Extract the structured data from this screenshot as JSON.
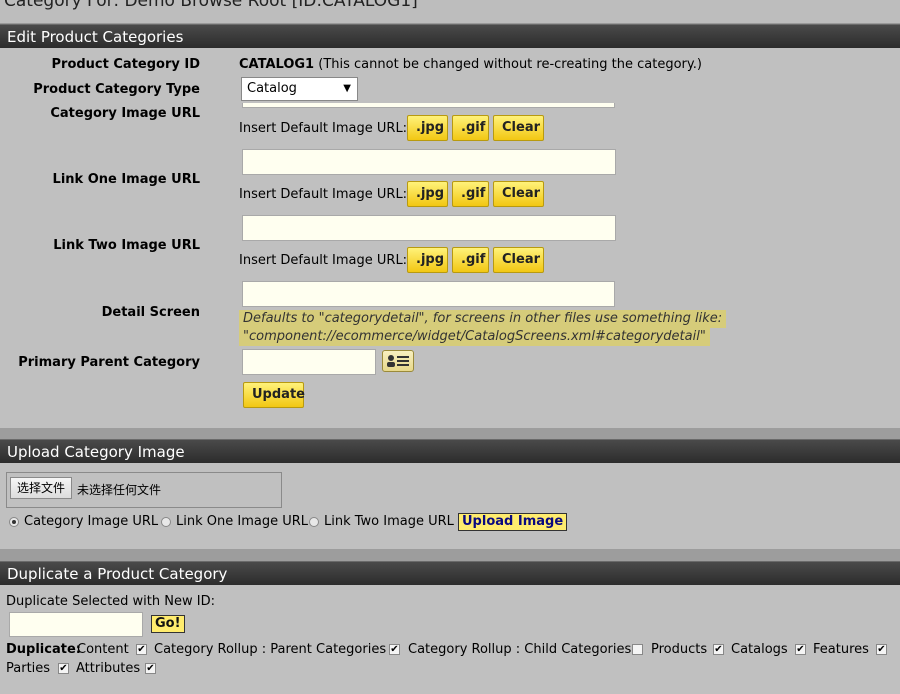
{
  "page_title": "Category For: Demo Browse Root [ID:CATALOG1]",
  "edit_section": {
    "title": "Edit Product Categories",
    "category_id_label": "Product Category ID",
    "category_id_value": "CATALOG1",
    "category_id_note": "(This cannot be changed without re-creating the category.)",
    "type_label": "Product Category Type",
    "type_value": "Catalog",
    "category_image_label": "Category Image URL",
    "link_one_label": "Link One Image URL",
    "link_two_label": "Link Two Image URL",
    "insert_default_label": "Insert Default Image URL:",
    "jpg_label": ".jpg",
    "gif_label": ".gif",
    "clear_label": "Clear",
    "detail_screen_label": "Detail Screen",
    "detail_screen_tooltip_line1": "Defaults to \"categorydetail\", for screens in other files use something like:",
    "detail_screen_tooltip_line2": "\"component://ecommerce/widget/CatalogScreens.xml#categorydetail\"",
    "primary_parent_label": "Primary Parent Category",
    "update_label": "Update"
  },
  "upload_section": {
    "title": "Upload Category Image",
    "choose_file_label": "选择文件",
    "no_file_label": "未选择任何文件",
    "radio_options": [
      "Category Image URL",
      "Link One Image URL",
      "Link Two Image URL"
    ],
    "selected_radio": "Category Image URL",
    "upload_label": "Upload Image"
  },
  "duplicate_section": {
    "title": "Duplicate a Product Category",
    "prompt": "Duplicate Selected with New ID:",
    "go_label": "Go!",
    "duplicate_label": "Duplicate:",
    "options": [
      {
        "label": "Content",
        "checked": true
      },
      {
        "label": "Category Rollup : Parent Categories",
        "checked": true
      },
      {
        "label": "Category Rollup : Child Categories",
        "checked": false
      },
      {
        "label": "Products",
        "checked": true
      },
      {
        "label": "Catalogs",
        "checked": true
      },
      {
        "label": "Features",
        "checked": true
      },
      {
        "label": "Parties",
        "checked": true
      },
      {
        "label": "Attributes",
        "checked": true
      }
    ]
  }
}
